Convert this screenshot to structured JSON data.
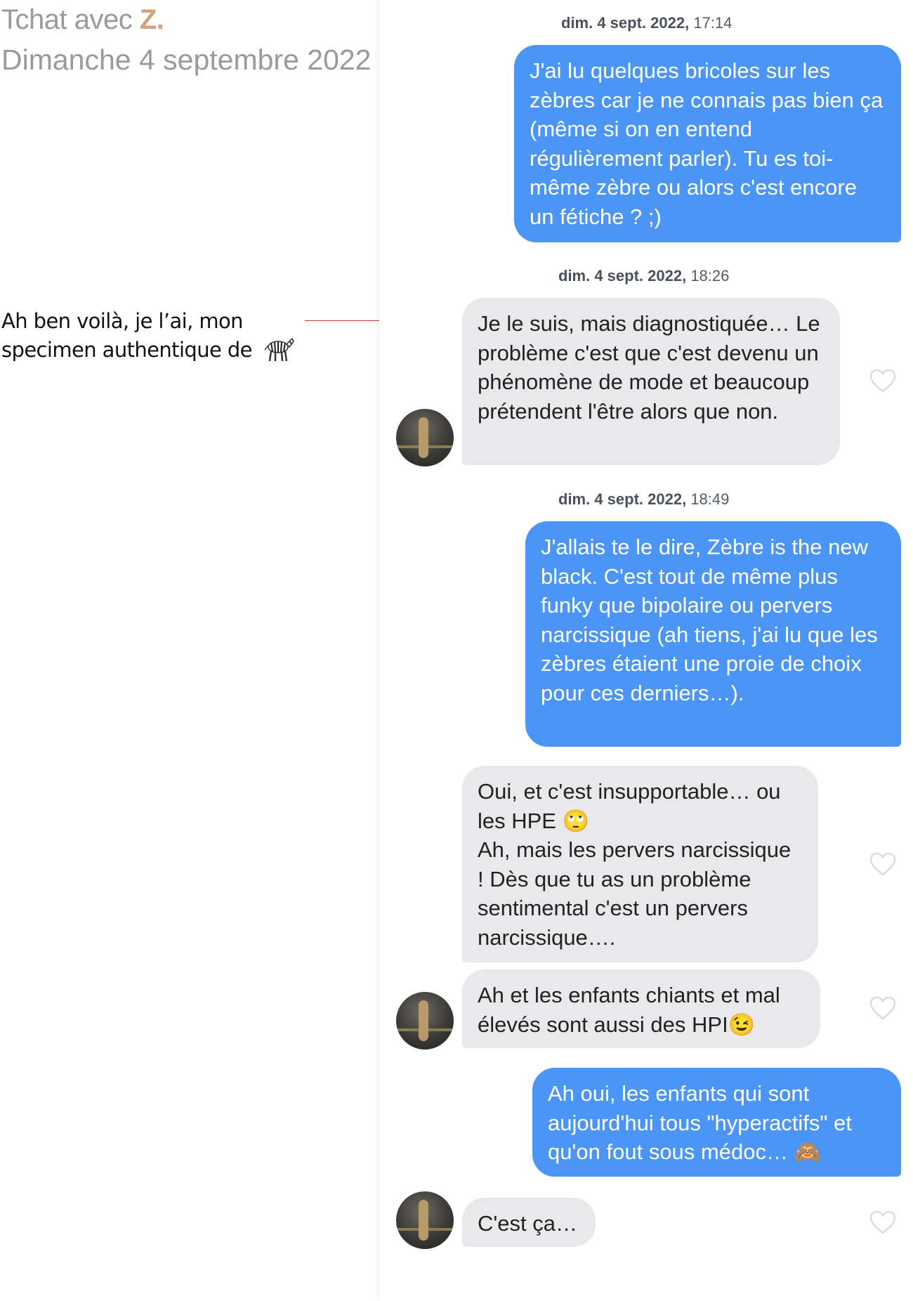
{
  "header": {
    "title_prefix": "Tchat avec ",
    "title_initial": "Z.",
    "subtitle": "Dimanche 4 septembre 2022"
  },
  "annotation": {
    "text": "Ah ben voilà, je l’ai, mon specimen authentique de",
    "emoji": "zebra-icon"
  },
  "chat": {
    "timestamps": [
      {
        "day": "dim. 4 sept. 2022,",
        "time": " 17:14"
      },
      {
        "day": "dim. 4 sept. 2022,",
        "time": " 18:26"
      },
      {
        "day": "dim. 4 sept. 2022,",
        "time": " 18:49"
      }
    ],
    "messages": [
      {
        "from": "me",
        "text": "J'ai lu quelques bricoles sur les zèbres car je ne connais pas bien ça (même si on en entend régulièrement parler). Tu es toi-même zèbre ou alors c'est encore un fétiche ? ;)"
      },
      {
        "from": "them",
        "text": "Je le suis, mais diagnostiquée… Le problème c'est que c'est devenu un phénomène de mode et beaucoup prétendent l'être alors que non."
      },
      {
        "from": "me",
        "text": "J'allais te le dire, Zèbre is the new black. C'est tout de même plus funky que bipolaire ou pervers narcissique (ah tiens, j'ai lu que les zèbres étaient une proie de choix pour ces derniers…)."
      },
      {
        "from": "them",
        "text": "Oui, et c'est insupportable… ou les HPE 🙄\nAh, mais les pervers narcissique  ! Dès que tu as un problème sentimental c'est un pervers narcissique…."
      },
      {
        "from": "them",
        "text": "Ah et les enfants chiants et mal élevés sont aussi des HPI😉"
      },
      {
        "from": "me",
        "text": "Ah oui, les enfants qui sont aujourd'hui tous \"hyperactifs\" et qu'on fout sous médoc… 🙈"
      },
      {
        "from": "them",
        "text": "C'est ça…"
      }
    ]
  },
  "colors": {
    "outgoing_bubble": "#4b95f7",
    "incoming_bubble": "#e9e9eb",
    "title_gray": "#9a9a9a",
    "initial_accent": "#d5a27f",
    "connector_line": "#c0393b"
  }
}
